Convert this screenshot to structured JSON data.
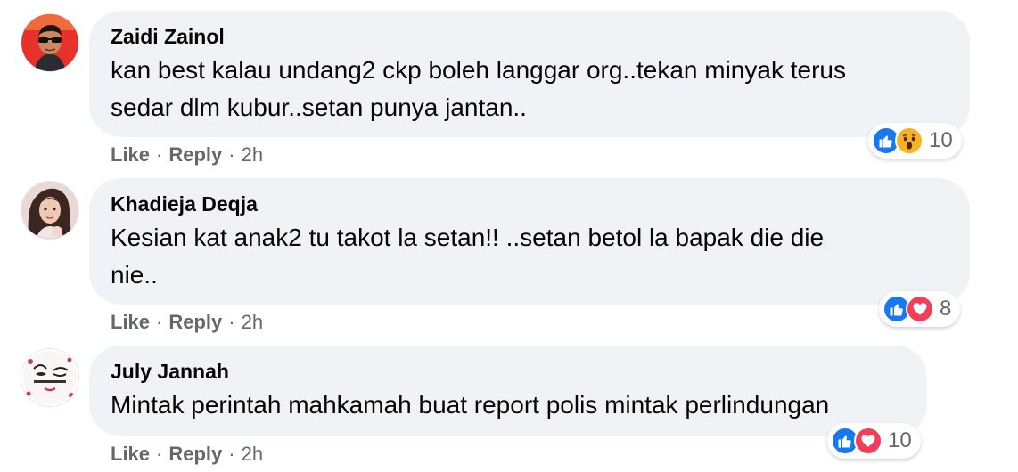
{
  "colors": {
    "bubble_bg": "#f0f2f5",
    "meta_text": "#65676b",
    "like_blue": "#1877f2",
    "love_red": "#f33e58",
    "wow_yellow": "#f7b125"
  },
  "comments": [
    {
      "author": "Zaidi Zainol",
      "text_lines": [
        "kan best kalau undang2 ckp boleh langgar org..tekan minyak terus",
        "sedar dlm kubur..setan punya jantan.."
      ],
      "reactions": [
        "like-icon",
        "wow-icon"
      ],
      "reaction_count": "10",
      "like_label": "Like",
      "reply_label": "Reply",
      "separator": "·",
      "time": "2h"
    },
    {
      "author": "Khadieja Deqja",
      "text_lines": [
        "Kesian kat anak2 tu takot la setan!! ..setan betol la bapak die die",
        "nie.."
      ],
      "reactions": [
        "like-icon",
        "love-icon"
      ],
      "reaction_count": "8",
      "like_label": "Like",
      "reply_label": "Reply",
      "separator": "·",
      "time": "2h"
    },
    {
      "author": "July Jannah",
      "text_lines": [
        "Mintak perintah mahkamah buat report polis mintak perlindungan"
      ],
      "reactions": [
        "like-icon",
        "love-icon"
      ],
      "reaction_count": "10",
      "like_label": "Like",
      "reply_label": "Reply",
      "separator": "·",
      "time": "2h"
    }
  ]
}
